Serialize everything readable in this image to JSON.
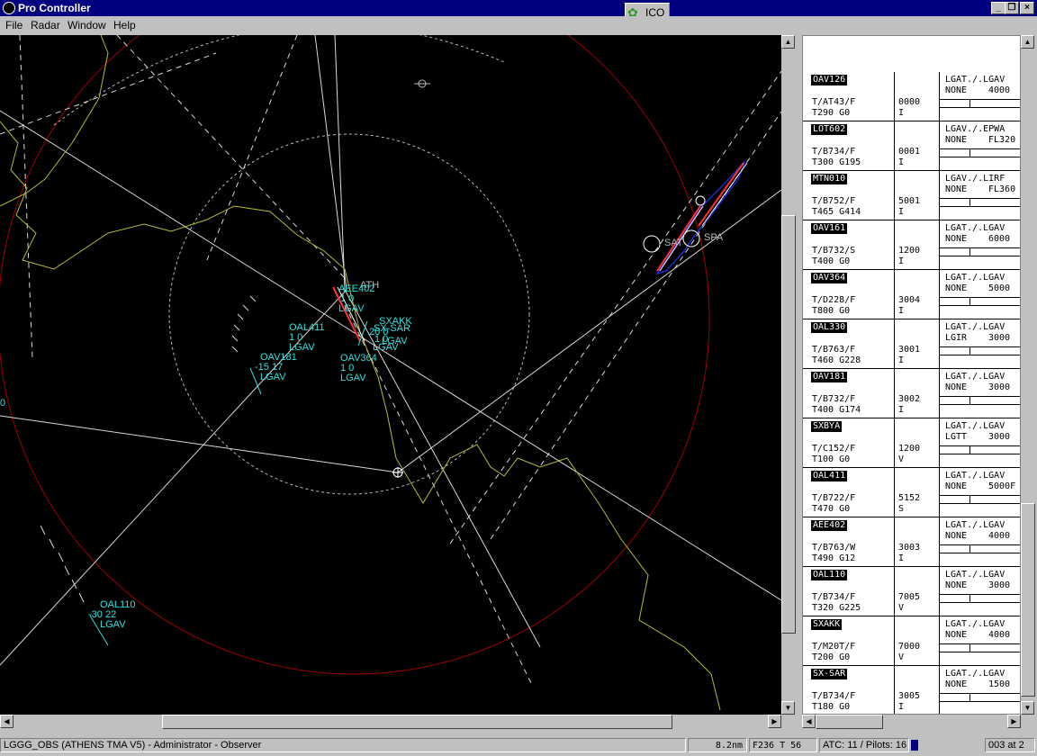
{
  "window": {
    "title": "Pro Controller",
    "icq_label": "ICQ",
    "icq_icon": "icq-flower-icon"
  },
  "menu": {
    "items": [
      "File",
      "Radar",
      "Window",
      "Help"
    ]
  },
  "radar": {
    "labels": {
      "sat": "SAT",
      "spa": "SPA",
      "ath": "ATH",
      "zero": "0",
      "oal411": [
        "OAL411",
        "1 0",
        "LGAV"
      ],
      "oav181": [
        "OAV181",
        "-15 17",
        "LGAV"
      ],
      "oav364": [
        "OAV364",
        "1 0",
        "LGAV"
      ],
      "aee402": [
        "AEE402",
        "1 0",
        "LGAV"
      ],
      "sxakk": [
        "SXAKK",
        "SX-SAR",
        "20 0",
        "1 0",
        "LGAV",
        "LGAV"
      ],
      "oal110": [
        "OAL110",
        "-30 22",
        "LGAV"
      ]
    },
    "colors": {
      "background": "#000000",
      "range_ring": "#a00000",
      "coastline": "#b9b936",
      "tag": "#33e0e0",
      "airway": "#d8d8d8",
      "sector": "#1a2ad0"
    }
  },
  "strips": [
    {
      "callsign": "OAV126",
      "type": "T/AT43/F",
      "alt": "T290 G0",
      "squawk": "0000",
      "rules": "I",
      "route": "LGAT./.LGAV",
      "alt_dest": "NONE",
      "cfl": "4000"
    },
    {
      "callsign": "LOT602",
      "type": "T/B734/F",
      "alt": "T300 G195",
      "squawk": "0001",
      "rules": "I",
      "route": "LGAV./.EPWA",
      "alt_dest": "NONE",
      "cfl": "FL320"
    },
    {
      "callsign": "MTN010",
      "type": "T/B752/F",
      "alt": "T465 G414",
      "squawk": "5001",
      "rules": "I",
      "route": "LGAV./.LIRF",
      "alt_dest": "NONE",
      "cfl": "FL360"
    },
    {
      "callsign": "OAV161",
      "type": "T/B732/S",
      "alt": "T400 G0",
      "squawk": "1200",
      "rules": "I",
      "route": "LGAT./.LGAV",
      "alt_dest": "NONE",
      "cfl": "6000"
    },
    {
      "callsign": "OAV364",
      "type": "T/D228/F",
      "alt": "T800 G0",
      "squawk": "3004",
      "rules": "I",
      "route": "LGAT./.LGAV",
      "alt_dest": "NONE",
      "cfl": "5000"
    },
    {
      "callsign": "OAL330",
      "type": "T/B763/F",
      "alt": "T460 G228",
      "squawk": "3001",
      "rules": "I",
      "route": "LGAT./.LGAV",
      "alt_dest": "LGIR",
      "cfl": "3000"
    },
    {
      "callsign": "OAV181",
      "type": "T/B732/F",
      "alt": "T400 G174",
      "squawk": "3002",
      "rules": "I",
      "route": "LGAT./.LGAV",
      "alt_dest": "NONE",
      "cfl": "3000"
    },
    {
      "callsign": "SXBYA",
      "type": "T/C152/F",
      "alt": "T100 G0",
      "squawk": "1200",
      "rules": "V",
      "route": "LGAT./.LGAV",
      "alt_dest": "LGTT",
      "cfl": "3000"
    },
    {
      "callsign": "OAL411",
      "type": "T/B722/F",
      "alt": "T470 G0",
      "squawk": "5152",
      "rules": "S",
      "route": "LGAT./.LGAV",
      "alt_dest": "NONE",
      "cfl": "5000F"
    },
    {
      "callsign": "AEE402",
      "type": "T/B763/W",
      "alt": "T490 G12",
      "squawk": "3003",
      "rules": "I",
      "route": "LGAT./.LGAV",
      "alt_dest": "NONE",
      "cfl": "4000"
    },
    {
      "callsign": "OAL110",
      "type": "T/B734/F",
      "alt": "T320 G225",
      "squawk": "7005",
      "rules": "V",
      "route": "LGAT./.LGAV",
      "alt_dest": "NONE",
      "cfl": "3000"
    },
    {
      "callsign": "SXAKK",
      "type": "T/M20T/F",
      "alt": "T200 G0",
      "squawk": "7000",
      "rules": "V",
      "route": "LGAT./.LGAV",
      "alt_dest": "NONE",
      "cfl": "4000"
    },
    {
      "callsign": "SX-SAR",
      "type": "T/B734/F",
      "alt": "T180 G0",
      "squawk": "3005",
      "rules": "I",
      "route": "LGAT./.LGAV",
      "alt_dest": "NONE",
      "cfl": "1500"
    }
  ],
  "status": {
    "connection": "LGGG_OBS (ATHENS TMA V5) - Administrator - Observer",
    "range": "8.2nm",
    "position": "F236  T  56",
    "counts": "ATC: 11 / Pilots: 16",
    "time": "003 at 2"
  }
}
